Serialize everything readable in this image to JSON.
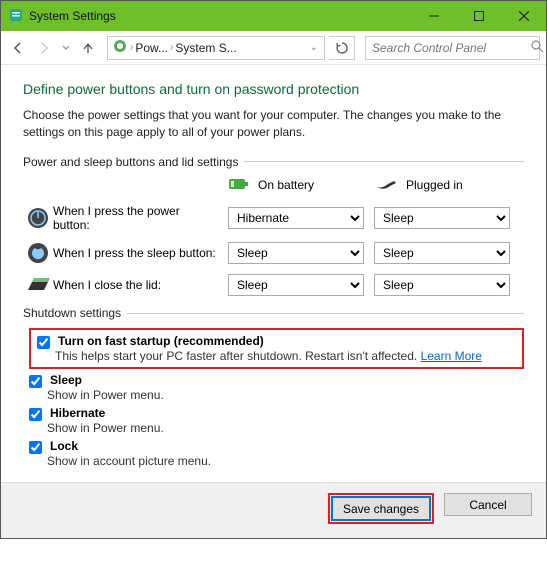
{
  "window": {
    "title": "System Settings"
  },
  "breadcrumb": {
    "item1": "Pow...",
    "item2": "System S..."
  },
  "search": {
    "placeholder": "Search Control Panel"
  },
  "heading": "Define power buttons and turn on password protection",
  "desc": "Choose the power settings that you want for your computer. The changes you make to the settings on this page apply to all of your power plans.",
  "group_buttons": "Power and sleep buttons and lid settings",
  "cols": {
    "battery": "On battery",
    "plugged": "Plugged in"
  },
  "rows": {
    "power": {
      "label": "When I press the power button:",
      "battery": "Hibernate",
      "plugged": "Sleep"
    },
    "sleep": {
      "label": "When I press the sleep button:",
      "battery": "Sleep",
      "plugged": "Sleep"
    },
    "lid": {
      "label": "When I close the lid:",
      "battery": "Sleep",
      "plugged": "Sleep"
    }
  },
  "group_shutdown": "Shutdown settings",
  "shutdown": {
    "fast": {
      "label": "Turn on fast startup (recommended)",
      "sub": "This helps start your PC faster after shutdown. Restart isn't affected. ",
      "link": "Learn More"
    },
    "sleep": {
      "label": "Sleep",
      "sub": "Show in Power menu."
    },
    "hibernate": {
      "label": "Hibernate",
      "sub": "Show in Power menu."
    },
    "lock": {
      "label": "Lock",
      "sub": "Show in account picture menu."
    }
  },
  "buttons": {
    "save": "Save changes",
    "cancel": "Cancel"
  }
}
